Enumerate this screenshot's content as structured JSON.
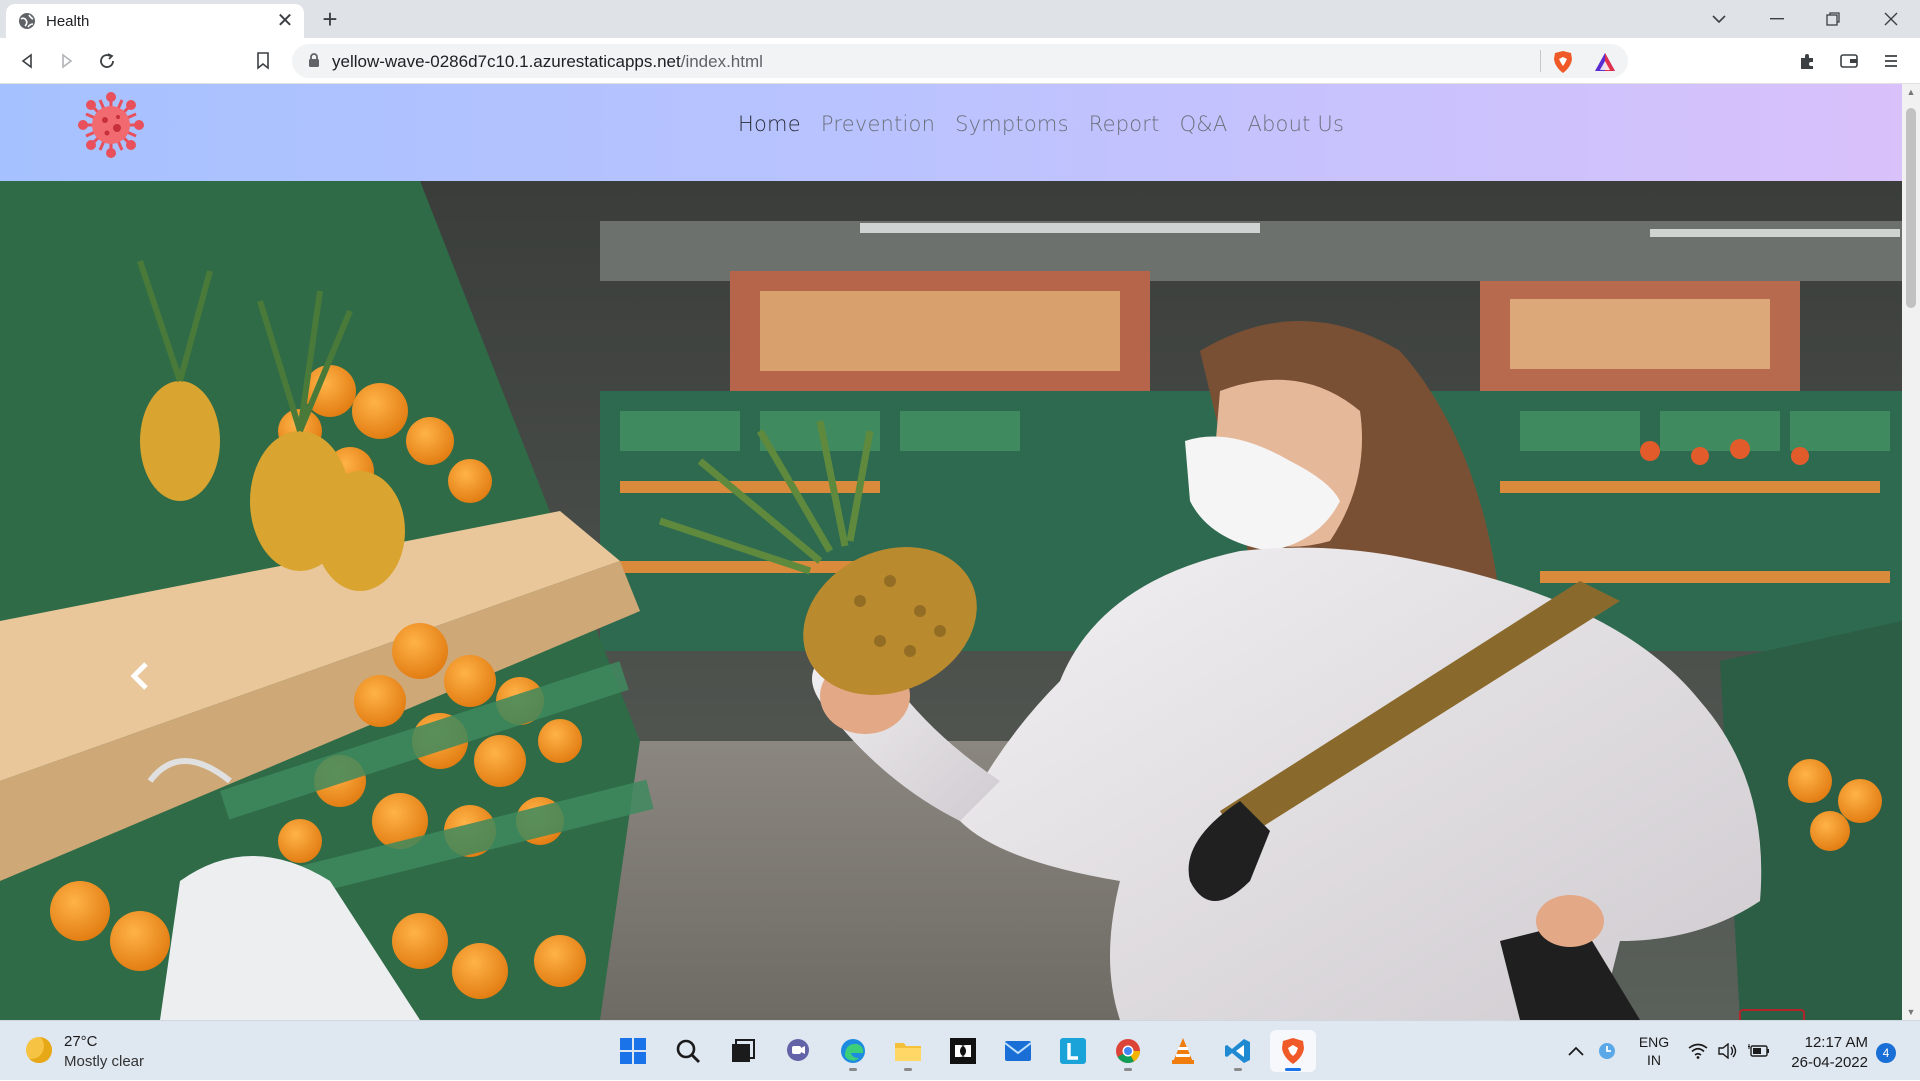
{
  "browser": {
    "tab": {
      "title": "Health"
    },
    "address": {
      "host": "yellow-wave-0286d7c10.1.azurestaticapps.net",
      "path": "/index.html"
    }
  },
  "site": {
    "nav_links": [
      "Home",
      "Prevention",
      "Symptoms",
      "Report",
      "Q&A",
      "About Us"
    ],
    "active_link": "Home",
    "colors": {
      "nav_start": "#a6c1ff",
      "nav_end": "#d9c1fb",
      "logo": "#e8505b"
    }
  },
  "hero": {
    "image_description": "Woman wearing a face mask holding a pineapple in a supermarket produce aisle",
    "prev_icon": "chevron-left-icon",
    "back_to_top_icon": "chevron-up-icon"
  },
  "taskbar": {
    "weather": {
      "temp": "27°C",
      "desc": "Mostly clear"
    },
    "apps": [
      "start",
      "search",
      "task-view",
      "teams-chat",
      "edge",
      "file-explorer",
      "dolby-access",
      "mail",
      "libby",
      "chrome",
      "vlc",
      "vscode",
      "brave"
    ],
    "tray": {
      "lang1": "ENG",
      "lang2": "IN"
    },
    "clock": {
      "time": "12:17 AM",
      "date": "26-04-2022"
    },
    "notifications": "4"
  }
}
